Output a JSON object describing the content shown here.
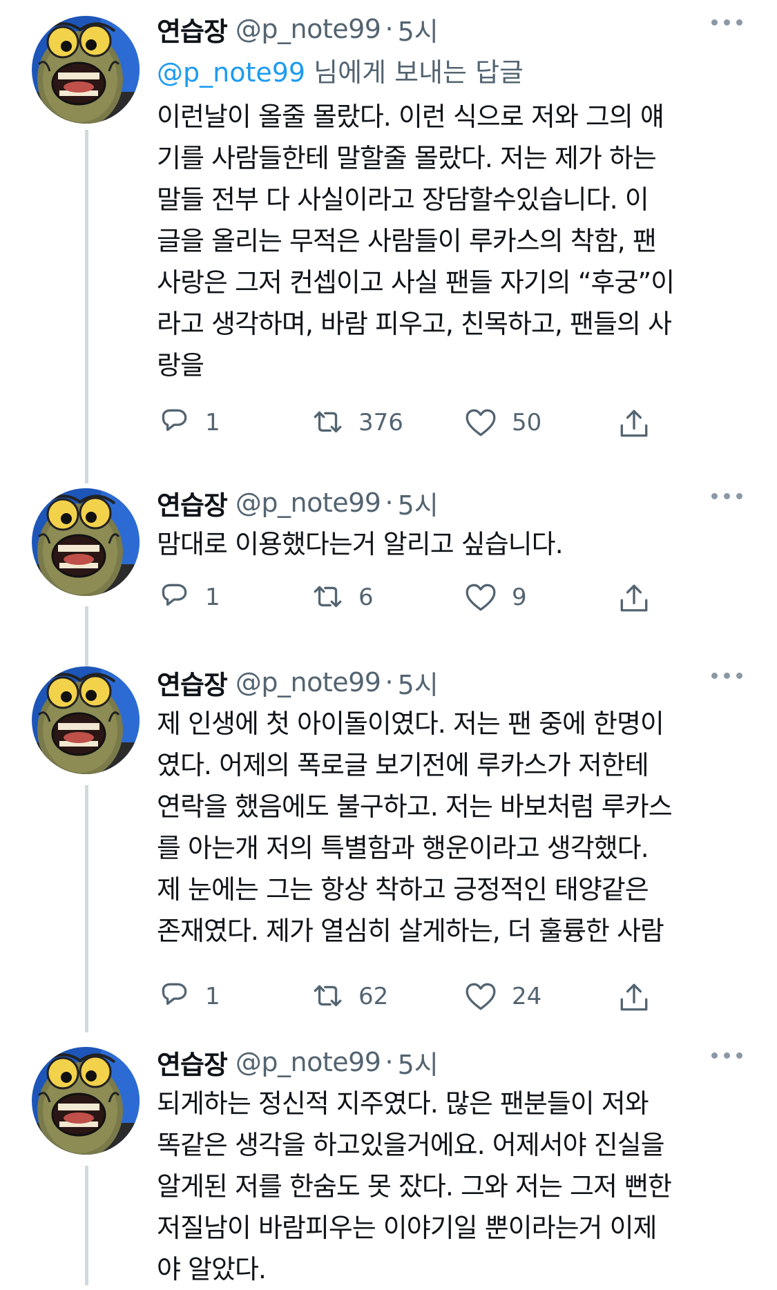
{
  "tweets": [
    {
      "name": "연습장",
      "handle": "@p_note99",
      "dot": "·",
      "time": "5시",
      "reply_mention": "@p_note99",
      "reply_suffix": " 님에게 보내는 답글",
      "text": "이런날이 올줄 몰랐다. 이런 식으로 저와 그의 얘\n기를 사람들한테 말할줄 몰랐다. 저는 제가 하는\n말들 전부 다 사실이라고 장담할수있습니다. 이\n글을 올리는 무적은 사람들이 루카스의 착함, 팬\n사랑은 그저 컨셉이고 사실 팬들 자기의 “후궁”이\n라고 생각하며, 바람 피우고, 친목하고, 팬들의 사\n랑을",
      "replies": "1",
      "retweets": "376",
      "likes": "50"
    },
    {
      "name": "연습장",
      "handle": "@p_note99",
      "dot": "·",
      "time": "5시",
      "text": "맘대로 이용했다는거 알리고 싶습니다.",
      "replies": "1",
      "retweets": "6",
      "likes": "9"
    },
    {
      "name": "연습장",
      "handle": "@p_note99",
      "dot": "·",
      "time": "5시",
      "text": "제 인생에 첫 아이돌이였다. 저는 팬 중에 한명이\n였다. 어제의 폭로글 보기전에 루카스가 저한테\n연락을 했음에도 불구하고. 저는 바보처럼 루카스\n를 아는개 저의 특별함과 행운이라고 생각했다.\n제 눈에는 그는 항상 착하고 긍정적인 태양같은\n존재였다. 제가 열심히 살게하는, 더 훌륭한 사람",
      "replies": "1",
      "retweets": "62",
      "likes": "24"
    },
    {
      "name": "연습장",
      "handle": "@p_note99",
      "dot": "·",
      "time": "5시",
      "text": "되게하는 정신적 지주였다. 많은 팬분들이 저와\n똑같은 생각을 하고있을거에요. 어제서야 진실을\n알게된 저를 한숨도 못 잤다. 그와 저는 그저 뻔한\n저질남이 바람피우는 이야기일 뿐이라는거 이제\n야 알았다."
    }
  ],
  "colors": {
    "accent": "#1d9bf0",
    "secondary_text": "#536471",
    "thread_line": "#cfd9de"
  },
  "icons": [
    "reply-icon",
    "retweet-icon",
    "like-icon",
    "share-icon",
    "more-icon",
    "avatar"
  ]
}
